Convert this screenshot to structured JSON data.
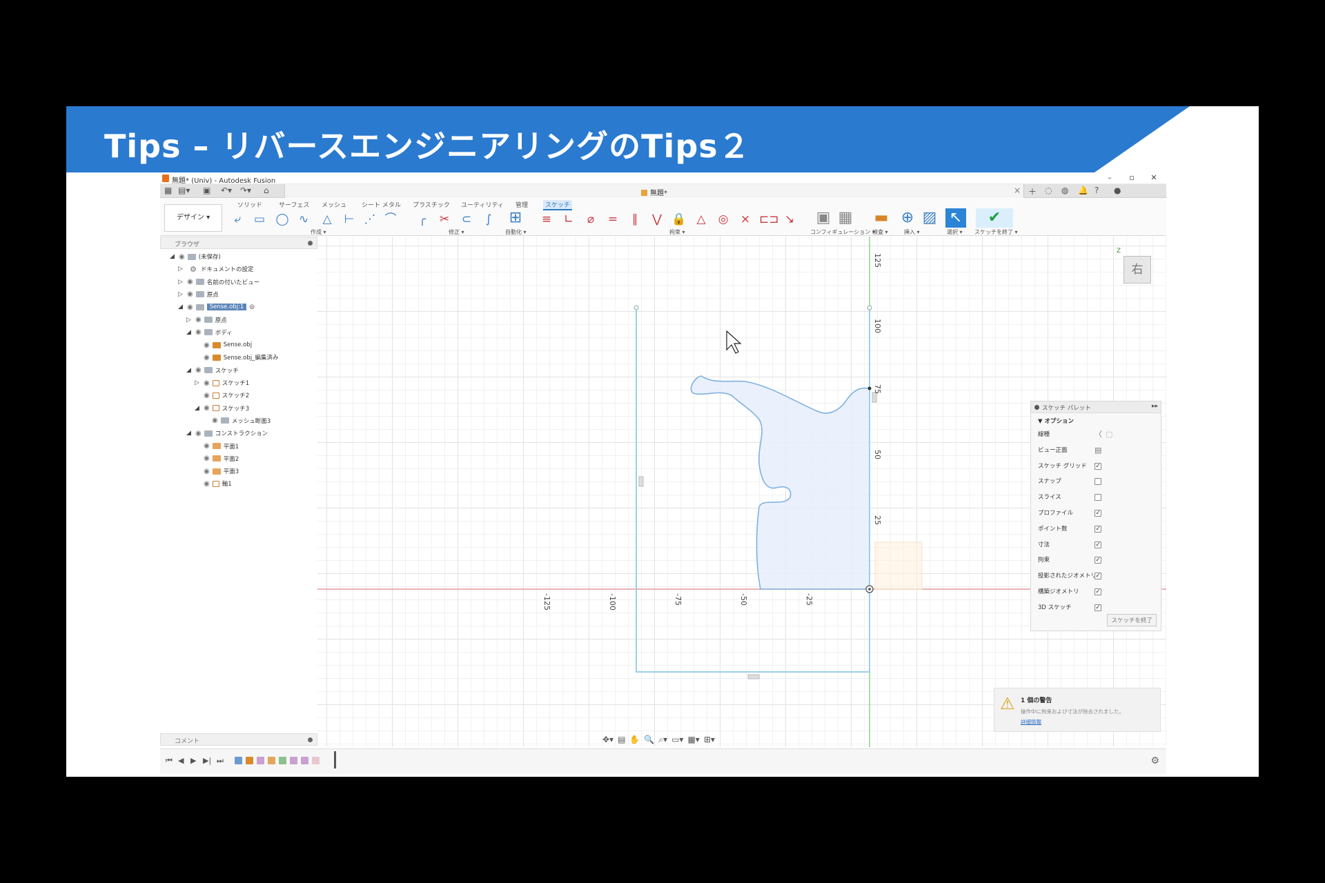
{
  "slide": {
    "title": "Tips – リバースエンジニアリングのTips２",
    "banner_color": "#2a7ad0"
  },
  "app": {
    "window_title": "無題* (Univ) - Autodesk Fusion",
    "document_tab": "無題*",
    "workspace": "デザイン ▾",
    "ribbon_tabs": [
      "ソリッド",
      "サーフェス",
      "メッシュ",
      "シート メタル",
      "プラスチック",
      "ユーティリティ",
      "管理",
      "スケッチ"
    ],
    "ribbon_groups": [
      "作成 ▾",
      "修正 ▾",
      "自動化 ▾",
      "拘束 ▾",
      "コンフィギュレーション ▾",
      "検査 ▾",
      "挿入 ▾",
      "選択 ▾",
      "スケッチを終了 ▾"
    ],
    "browser": {
      "header": "ブラウザ",
      "nodes": [
        {
          "label": "(未保存)",
          "depth": 0,
          "arrow": "◢",
          "icon": "doc"
        },
        {
          "label": "ドキュメントの設定",
          "depth": 1,
          "arrow": "▷",
          "icon": "gear"
        },
        {
          "label": "名前の付いたビュー",
          "depth": 1,
          "arrow": "▷",
          "icon": "folder"
        },
        {
          "label": "原点",
          "depth": 1,
          "arrow": "▷",
          "icon": "folder"
        },
        {
          "label": "Sense.obj:1",
          "depth": 1,
          "arrow": "◢",
          "icon": "folder",
          "highlight": true
        },
        {
          "label": "原点",
          "depth": 2,
          "arrow": "▷",
          "icon": "folder"
        },
        {
          "label": "ボディ",
          "depth": 2,
          "arrow": "◢",
          "icon": "folder"
        },
        {
          "label": "Sense.obj",
          "depth": 3,
          "arrow": "",
          "icon": "orange"
        },
        {
          "label": "Sense.obj_編集済み",
          "depth": 3,
          "arrow": "",
          "icon": "orange"
        },
        {
          "label": "スケッチ",
          "depth": 2,
          "arrow": "◢",
          "icon": "folder"
        },
        {
          "label": "スケッチ1",
          "depth": 3,
          "arrow": "▷",
          "icon": "sketch"
        },
        {
          "label": "スケッチ2",
          "depth": 3,
          "arrow": "",
          "icon": "sketch"
        },
        {
          "label": "スケッチ3",
          "depth": 3,
          "arrow": "◢",
          "icon": "sketch"
        },
        {
          "label": "メッシュ断面3",
          "depth": 4,
          "arrow": "",
          "icon": "mesh"
        },
        {
          "label": "コンストラクション",
          "depth": 2,
          "arrow": "◢",
          "icon": "folder"
        },
        {
          "label": "平面1",
          "depth": 3,
          "arrow": "",
          "icon": "plane"
        },
        {
          "label": "平面2",
          "depth": 3,
          "arrow": "",
          "icon": "plane"
        },
        {
          "label": "平面3",
          "depth": 3,
          "arrow": "",
          "icon": "plane"
        },
        {
          "label": "軸1",
          "depth": 3,
          "arrow": "",
          "icon": "sketch"
        }
      ]
    },
    "comment_panel": "コメント",
    "view_cube": {
      "face": "右",
      "axis": "Z"
    },
    "axis_labels": {
      "x": [
        "-125",
        "-100",
        "-75",
        "-50",
        "-25"
      ],
      "y": [
        "125",
        "100",
        "75",
        "50",
        "25"
      ]
    },
    "sketch_palette": {
      "title": "スケッチ パレット",
      "section": "▼ オプション",
      "rows": [
        {
          "label": "線種",
          "type": "icon"
        },
        {
          "label": "ビュー正面",
          "type": "icon"
        },
        {
          "label": "スケッチ グリッド",
          "type": "check",
          "checked": true
        },
        {
          "label": "スナップ",
          "type": "check",
          "checked": false
        },
        {
          "label": "スライス",
          "type": "check",
          "checked": false
        },
        {
          "label": "プロファイル",
          "type": "check",
          "checked": true
        },
        {
          "label": "ポイント数",
          "type": "check",
          "checked": true
        },
        {
          "label": "寸法",
          "type": "check",
          "checked": true
        },
        {
          "label": "拘束",
          "type": "check",
          "checked": true
        },
        {
          "label": "投影されたジオメトリ",
          "type": "check",
          "checked": true
        },
        {
          "label": "構築ジオメトリ",
          "type": "check",
          "checked": true
        },
        {
          "label": "3D スケッチ",
          "type": "check",
          "checked": true
        }
      ],
      "finish_button": "スケッチを終了"
    },
    "warning": {
      "title": "1 個の警告",
      "detail": "操作中に拘束および寸法が除去されました。",
      "link": "詳細情報"
    }
  }
}
